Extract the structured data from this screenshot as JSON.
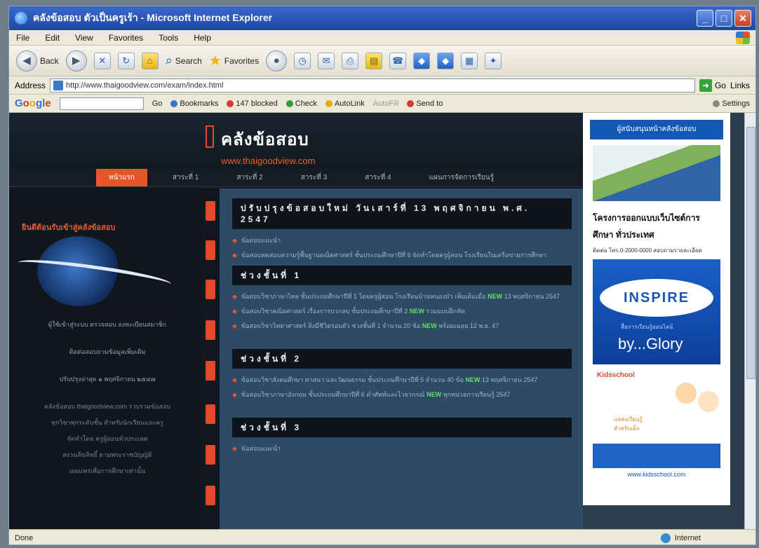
{
  "window": {
    "title": "คลังข้อสอบ ตัวเป็นครูเร้า - Microsoft Internet Explorer",
    "controls": [
      "_",
      "□",
      "✕"
    ]
  },
  "menu": [
    "File",
    "Edit",
    "View",
    "Favorites",
    "Tools",
    "Help"
  ],
  "toolbar": {
    "back_label": "Back",
    "search_label": "Search",
    "favorites_label": "Favorites"
  },
  "address": {
    "label": "Address",
    "url": "http://www.thaigoodview.com/exam/index.html",
    "go_label": "Go",
    "links_label": "Links"
  },
  "googlebar": {
    "logo": "Google",
    "go_label": "Go",
    "bookmarks_label": "Bookmarks",
    "pagerank_label": "147 blocked",
    "check_label": "Check",
    "autolink_label": "AutoLink",
    "autofill_label": "AutoFill",
    "sendto_label": "Send to",
    "settings_label": "Settings"
  },
  "site": {
    "title": "คลังข้อสอบ",
    "url": "www.thaigoodview.com",
    "nav": [
      "หน้าแรก",
      "สาระที่ 1",
      "สาระที่ 2",
      "สาระที่ 3",
      "สาระที่ 4",
      "แผนการจัดการเรียนรู้"
    ],
    "left_heading": "ยินดีต้อนรับเข้าสู่คลังข้อสอบ",
    "left_links": [
      "ผู้ใช้เข้าสู่ระบบ ตรวจสอบ ลงทะเบียนสมาชิก",
      "ติดต่อสอบถามข้อมูลเพิ่มเติม",
      "ปรับปรุงล่าสุด ๑ พฤศจิกายน ๒๕๔๗"
    ],
    "left_small": [
      "คลังข้อสอบ thaigoodview.com รวบรวมข้อสอบ",
      "ทุกวิชาทุกระดับชั้น สำหรับนักเรียนและครู",
      "จัดทำโดย ครูผู้สอนทั่วประเทศ",
      "สงวนลิขสิทธิ์ ตามพระราชบัญญัติ",
      "เผยแพร่เพื่อการศึกษาเท่านั้น"
    ],
    "sections": [
      {
        "title": "ปรับปรุงข้อสอบใหม่ วันเสาร์ที่ 13 พฤศจิกายน พ.ศ. 2547",
        "items": [
          {
            "text": "ข้อสอบแนะนำ",
            "hl": "",
            "tail": ""
          },
          {
            "text": "ข้อสอบทดสอบความรู้พื้นฐานคณิตศาสตร์ ชั้นประถมศึกษาปีที่ 6 จัดทำโดยครูผู้สอน โรงเรียนในเครือข่ายการศึกษา",
            "hl": "",
            "tail": ""
          }
        ]
      },
      {
        "title": "ช่วงชั้นที่ 1",
        "items": [
          {
            "text": "ข้อสอบวิชาภาษาไทย ชั้นประถมศึกษาปีที่ 1 โดยครูผู้สอน โรงเรียนบ้านหนองบัว เพิ่มเติมเมื่อ ",
            "hl": "NEW",
            "tail": " 13 พฤศจิกายน 2547"
          },
          {
            "text": "ข้อสอบวิชาคณิตศาสตร์ เรื่องการบวกลบ ชั้นประถมศึกษาปีที่ 2 ",
            "hl": "NEW",
            "tail": " รวมแบบฝึกหัด"
          },
          {
            "text": "ข้อสอบวิชาวิทยาศาสตร์ สิ่งมีชีวิตรอบตัว ช่วงชั้นที่ 1 จำนวน 20 ข้อ ",
            "hl": "NEW",
            "tail": " พร้อมเฉลย 12 พ.ย. 47"
          }
        ]
      },
      {
        "title": "ช่วงชั้นที่ 2",
        "items": [
          {
            "text": "ข้อสอบวิชาสังคมศึกษา ศาสนา และวัฒนธรรม ชั้นประถมศึกษาปีที่ 5 จำนวน 40 ข้อ ",
            "hl": "NEW",
            "tail": " 13 พฤศจิกายน 2547"
          },
          {
            "text": "ข้อสอบวิชาภาษาอังกฤษ ชั้นประถมศึกษาปีที่ 6 คำศัพท์และไวยากรณ์ ",
            "hl": "NEW",
            "tail": " ทุกหน่วยการเรียนรู้ 2547"
          }
        ]
      },
      {
        "title": "ช่วงชั้นที่ 3",
        "items": [
          {
            "text": "ข้อสอบแนะนำ",
            "hl": "",
            "tail": ""
          }
        ]
      }
    ]
  },
  "ads": {
    "banner": "ผู้สนับสนุนหน้าคลังข้อสอบ",
    "text1": "โครงการออกแบบเว็บไซต์การศึกษา ทั่วประเทศ",
    "text2": "ติดต่อ โทร.0-2000-0000 สอบถามรายละเอียด",
    "inspire": "INSPIRE",
    "inspire_sub": "สื่อการเรียนรู้ออนไลน์",
    "by": "by...Glory",
    "kids_logo": "Kidsschool",
    "kids_caption": "แหล่งเรียนรู้ สำหรับเด็ก",
    "url": "www.kidsschool.com"
  },
  "status": {
    "left": "Done",
    "zone": "Internet"
  },
  "colors": {
    "accent": "#e8552b",
    "content_bg": "#2d4a66",
    "highlight": "#5ee25e"
  }
}
